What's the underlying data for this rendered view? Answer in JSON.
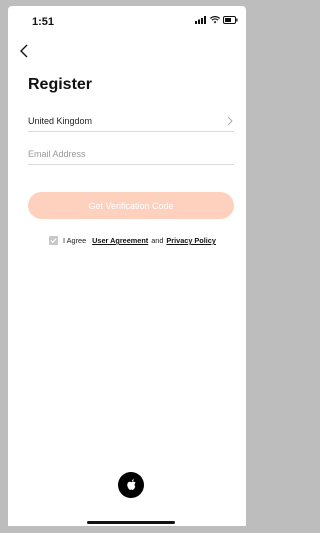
{
  "status": {
    "time": "1:51"
  },
  "page": {
    "title": "Register"
  },
  "form": {
    "country": "United Kingdom",
    "email_placeholder": "Email Address",
    "email_value": ""
  },
  "button": {
    "label": "Get Verification Code"
  },
  "agreement": {
    "prefix": "I Agree",
    "user_agreement": "User Agreement",
    "and": "and",
    "privacy_policy": "Privacy Policy"
  },
  "colors": {
    "accent": "#fdd1bd",
    "checkbox": "#c8c8c8"
  },
  "icons": {
    "back": "chevron-left-icon",
    "country_arrow": "chevron-right-icon",
    "checkbox": "checkmark-icon",
    "social": "apple-icon"
  }
}
